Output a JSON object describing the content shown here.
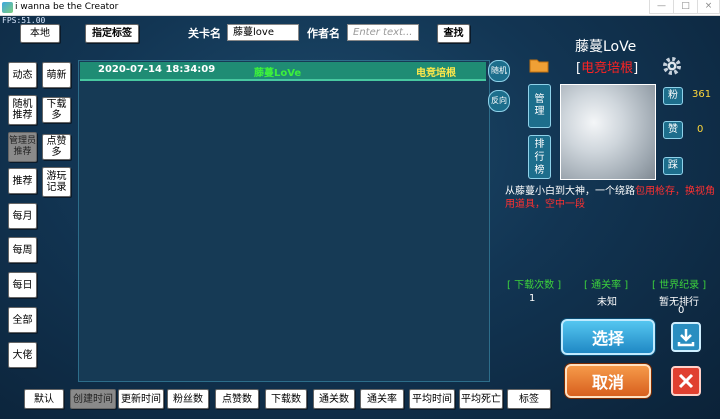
{
  "window": {
    "title": "i wanna be the Creator",
    "fps": "FPS:51.00",
    "minimize": "—",
    "maximize": "□",
    "close": "×"
  },
  "top": {
    "local": "本地",
    "assigned_tags": "指定标签",
    "level_name_label": "关卡名",
    "level_name_value": "藤蔓love",
    "author_label": "作者名",
    "author_placeholder": "Enter text...",
    "search": "查找"
  },
  "left_menu": [
    {
      "label": "动态"
    },
    {
      "label": "萌新"
    },
    {
      "label": "随机\n推荐"
    },
    {
      "label": "下载多"
    },
    {
      "label": "管理员\n推荐"
    },
    {
      "label": "点赞多"
    },
    {
      "label": "推荐"
    },
    {
      "label": "游玩\n记录"
    },
    {
      "label": "每月"
    },
    {
      "label": "每周"
    },
    {
      "label": "每日"
    },
    {
      "label": "全部"
    },
    {
      "label": "大佬"
    }
  ],
  "list": {
    "rows": [
      {
        "date": "2020-07-14 18:34:09",
        "author": "藤蔓LoVe",
        "tag": "电竞培根"
      }
    ]
  },
  "side": {
    "random": "随机",
    "reverse": "反向"
  },
  "profile": {
    "name": "藤蔓LoVe",
    "title_open": "[",
    "title": "电竞培根",
    "title_close": "]",
    "manage": "管\n理",
    "ranking": "排\n行\n榜",
    "fans_label": "粉",
    "fans_value": "361",
    "likes_label": "赞",
    "likes_value": "0",
    "step_label": "踩",
    "bio_white": "从藤蔓小白到大神，一个绕路",
    "bio_red": "包用枪存，换视角用道具，空中一段"
  },
  "stats": {
    "downloads_label": "[ 下载次数 ]",
    "downloads_value": "1",
    "clear_label": "[ 通关率 ]",
    "clear_value": "未知",
    "record_label": "[ 世界纪录 ]",
    "record_value": "暂无排行",
    "record_value2": "0"
  },
  "actions": {
    "select": "选择",
    "cancel": "取消",
    "download_icon": "download-icon",
    "close_icon": "close-icon"
  },
  "sort_bar": [
    "默认",
    "创建时间",
    "更新时间",
    "粉丝数",
    "点赞数",
    "下载数",
    "通关数",
    "通关率",
    "平均时间",
    "平均死亡",
    "标签"
  ],
  "colors": {
    "row_green": "#1f8c74",
    "stat_green": "#3cd23c",
    "accent_red": "#ff2222",
    "select_blue": "#2aa3d8",
    "cancel_orange": "#e8702a"
  }
}
